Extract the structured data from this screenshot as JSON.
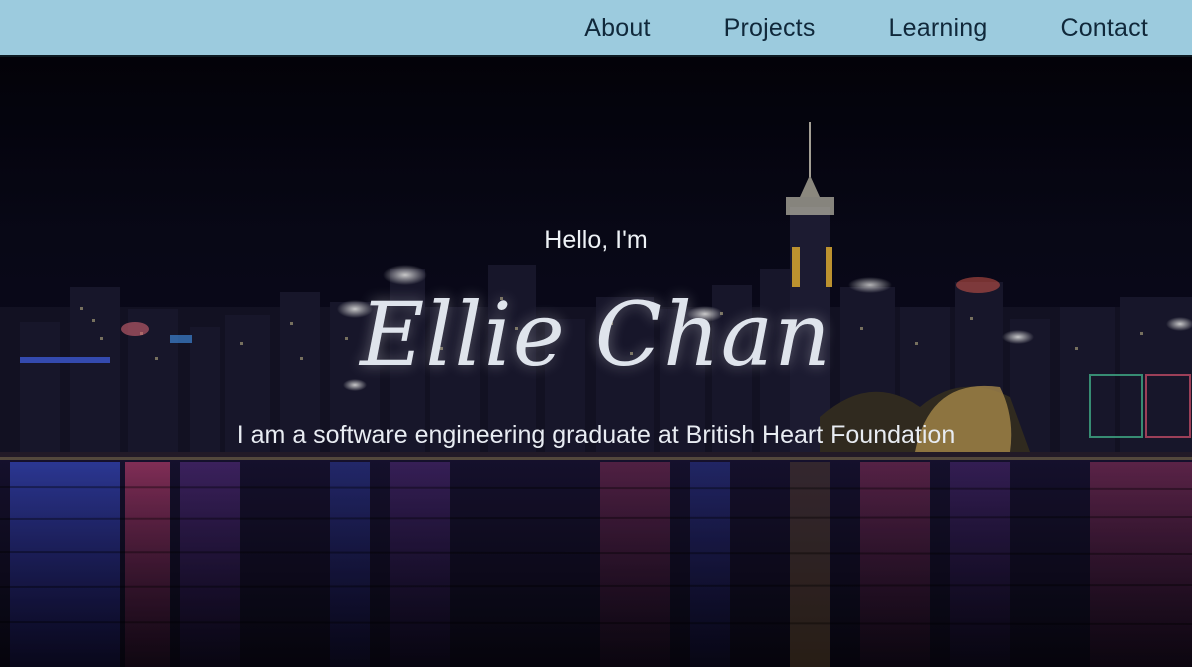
{
  "nav": {
    "items": [
      {
        "label": "About"
      },
      {
        "label": "Projects"
      },
      {
        "label": "Learning"
      },
      {
        "label": "Contact"
      }
    ]
  },
  "hero": {
    "greeting": "Hello, I'm",
    "name": "Ellie Chan",
    "tagline": "I am a software engineering graduate at British Heart Foundation",
    "background_image": "night city skyline over harbour"
  },
  "colors": {
    "nav_background": "#9ccbde",
    "nav_text": "#10283a",
    "hero_text": "#e8ecf2"
  }
}
